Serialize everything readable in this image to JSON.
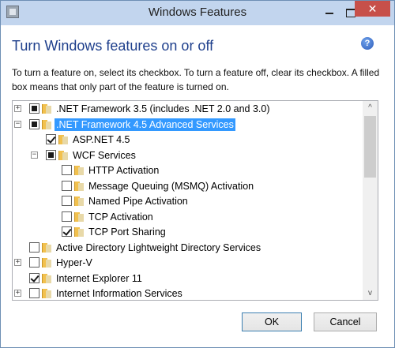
{
  "window": {
    "title": "Windows Features",
    "icon": "windows-features-icon",
    "close_glyph": "✕"
  },
  "header": {
    "title": "Turn Windows features on or off",
    "help_glyph": "?",
    "description": "To turn a feature on, select its checkbox. To turn a feature off, clear its checkbox. A filled box means that only part of the feature is turned on."
  },
  "features": [
    {
      "label": ".NET Framework 3.5 (includes .NET 2.0 and 3.0)",
      "expander": "+",
      "state": "partial",
      "level": 0,
      "selected": false
    },
    {
      "label": ".NET Framework 4.5 Advanced Services",
      "expander": "−",
      "state": "partial",
      "level": 0,
      "selected": true
    },
    {
      "label": "ASP.NET 4.5",
      "expander": "",
      "state": "checked",
      "level": 1,
      "selected": false
    },
    {
      "label": "WCF Services",
      "expander": "−",
      "state": "partial",
      "level": 1,
      "selected": false
    },
    {
      "label": "HTTP Activation",
      "expander": "",
      "state": "unchecked",
      "level": 2,
      "selected": false
    },
    {
      "label": "Message Queuing (MSMQ) Activation",
      "expander": "",
      "state": "unchecked",
      "level": 2,
      "selected": false
    },
    {
      "label": "Named Pipe Activation",
      "expander": "",
      "state": "unchecked",
      "level": 2,
      "selected": false
    },
    {
      "label": "TCP Activation",
      "expander": "",
      "state": "unchecked",
      "level": 2,
      "selected": false
    },
    {
      "label": "TCP Port Sharing",
      "expander": "",
      "state": "checked",
      "level": 2,
      "selected": false
    },
    {
      "label": "Active Directory Lightweight Directory Services",
      "expander": "",
      "state": "unchecked",
      "level": 0,
      "selected": false
    },
    {
      "label": "Hyper-V",
      "expander": "+",
      "state": "unchecked",
      "level": 0,
      "selected": false
    },
    {
      "label": "Internet Explorer 11",
      "expander": "",
      "state": "checked",
      "level": 0,
      "selected": false
    },
    {
      "label": "Internet Information Services",
      "expander": "+",
      "state": "unchecked",
      "level": 0,
      "selected": false
    }
  ],
  "buttons": {
    "ok": "OK",
    "cancel": "Cancel"
  },
  "scroll": {
    "up_glyph": "^",
    "down_glyph": "v"
  },
  "colors": {
    "selection": "#3399ff",
    "heading": "#1e3f8c",
    "titlebar": "#c2d5ee",
    "close_button": "#c7504a"
  }
}
